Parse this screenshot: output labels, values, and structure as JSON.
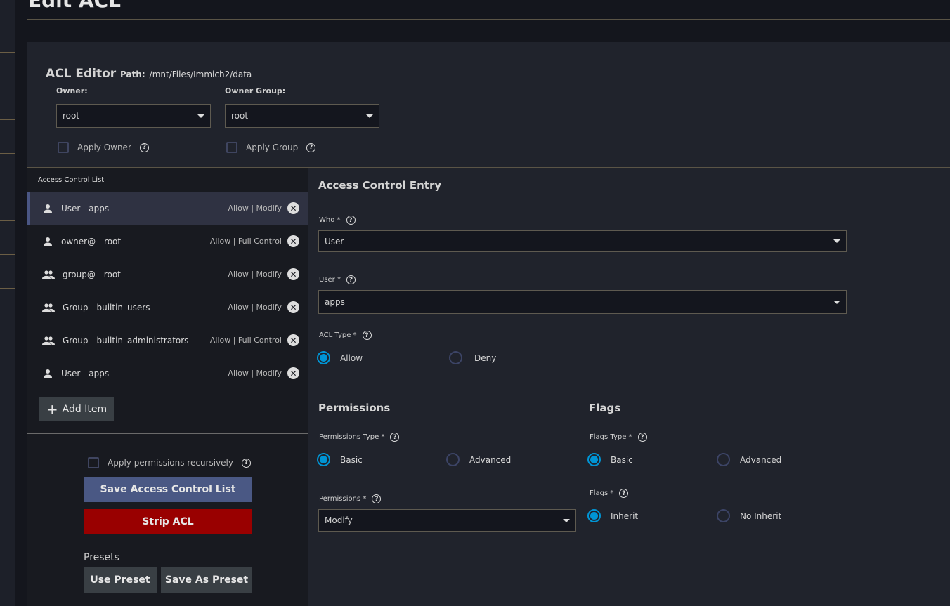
{
  "page": {
    "title": "Edit ACL"
  },
  "editor": {
    "title": "ACL Editor",
    "path_label": "Path:",
    "path": "/mnt/Files/Immich2/data",
    "owner_label": "Owner:",
    "owner_value": "root",
    "owner_group_label": "Owner Group:",
    "owner_group_value": "root",
    "apply_owner": "Apply Owner",
    "apply_group": "Apply Group"
  },
  "acl_list": {
    "title": "Access Control List",
    "items": [
      {
        "name": "User - apps",
        "status": "Allow | Modify",
        "icon": "person-icon"
      },
      {
        "name": "owner@ - root",
        "status": "Allow | Full Control",
        "icon": "person-icon"
      },
      {
        "name": "group@ - root",
        "status": "Allow | Modify",
        "icon": "group-icon"
      },
      {
        "name": "Group - builtin_users",
        "status": "Allow | Modify",
        "icon": "group-icon"
      },
      {
        "name": "Group - builtin_administrators",
        "status": "Allow | Full Control",
        "icon": "group-icon"
      },
      {
        "name": "User - apps",
        "status": "Allow | Modify",
        "icon": "person-icon"
      }
    ],
    "add_item": "Add Item"
  },
  "actions": {
    "recursive": "Apply permissions recursively",
    "save": "Save Access Control List",
    "strip": "Strip ACL",
    "presets_title": "Presets",
    "use_preset": "Use Preset",
    "save_preset": "Save As Preset"
  },
  "entry": {
    "title": "Access Control Entry",
    "who_label": "Who *",
    "who_value": "User",
    "user_label": "User *",
    "user_value": "apps",
    "acl_type_label": "ACL Type *",
    "allow": "Allow",
    "deny": "Deny",
    "permissions_title": "Permissions",
    "perm_type_label": "Permissions Type *",
    "basic": "Basic",
    "advanced": "Advanced",
    "permissions_label": "Permissions *",
    "permissions_value": "Modify",
    "flags_title": "Flags",
    "flags_type_label": "Flags Type *",
    "flags_label": "Flags *",
    "inherit": "Inherit",
    "no_inherit": "No Inherit"
  },
  "colors": {
    "accent": "#0095d5",
    "save": "#4a5884",
    "strip": "#990000"
  }
}
